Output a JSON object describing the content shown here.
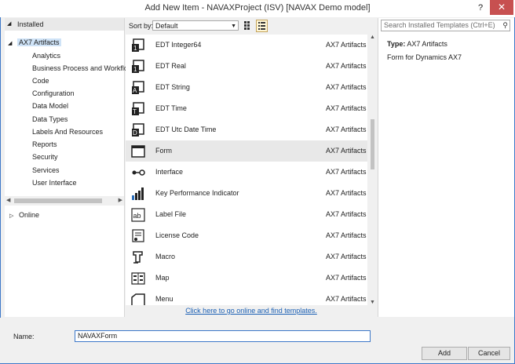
{
  "window": {
    "title": "Add New Item - NAVAXProject (ISV) [NAVAX Demo model]",
    "help_label": "?",
    "close_label": "✕"
  },
  "left_panel": {
    "installed_label": "Installed",
    "root_label": "AX7 Artifacts",
    "children": [
      "Analytics",
      "Business Process and Workflow",
      "Code",
      "Configuration",
      "Data Model",
      "Data Types",
      "Labels And Resources",
      "Reports",
      "Security",
      "Services",
      "User Interface"
    ],
    "online_label": "Online"
  },
  "sort": {
    "label": "Sort by:",
    "value": "Default"
  },
  "templates": [
    {
      "name": "EDT Integer64",
      "category": "AX7 Artifacts",
      "icon": "edt-integer-icon"
    },
    {
      "name": "EDT Real",
      "category": "AX7 Artifacts",
      "icon": "edt-real-icon"
    },
    {
      "name": "EDT String",
      "category": "AX7 Artifacts",
      "icon": "edt-string-icon"
    },
    {
      "name": "EDT Time",
      "category": "AX7 Artifacts",
      "icon": "edt-time-icon"
    },
    {
      "name": "EDT Utc Date Time",
      "category": "AX7 Artifacts",
      "icon": "edt-utc-date-time-icon"
    },
    {
      "name": "Form",
      "category": "AX7 Artifacts",
      "icon": "form-icon"
    },
    {
      "name": "Interface",
      "category": "AX7 Artifacts",
      "icon": "interface-icon"
    },
    {
      "name": "Key Performance Indicator",
      "category": "AX7 Artifacts",
      "icon": "kpi-icon"
    },
    {
      "name": "Label File",
      "category": "AX7 Artifacts",
      "icon": "label-file-icon"
    },
    {
      "name": "License Code",
      "category": "AX7 Artifacts",
      "icon": "license-code-icon"
    },
    {
      "name": "Macro",
      "category": "AX7 Artifacts",
      "icon": "macro-icon"
    },
    {
      "name": "Map",
      "category": "AX7 Artifacts",
      "icon": "map-icon"
    },
    {
      "name": "Menu",
      "category": "AX7 Artifacts",
      "icon": "menu-icon"
    }
  ],
  "online_link": "Click here to go online and find templates.",
  "search": {
    "placeholder": "Search Installed Templates (Ctrl+E)"
  },
  "details": {
    "type_label": "Type:",
    "type_value": "AX7 Artifacts",
    "description": "Form for Dynamics AX7"
  },
  "name_field": {
    "label": "Name:",
    "value": "NAVAXForm"
  },
  "buttons": {
    "add": "Add",
    "cancel": "Cancel"
  },
  "colors": {
    "accent": "#3d78c8",
    "selected_tree": "#cfe3f7",
    "link": "#1a5fb4",
    "close": "#c75050"
  }
}
